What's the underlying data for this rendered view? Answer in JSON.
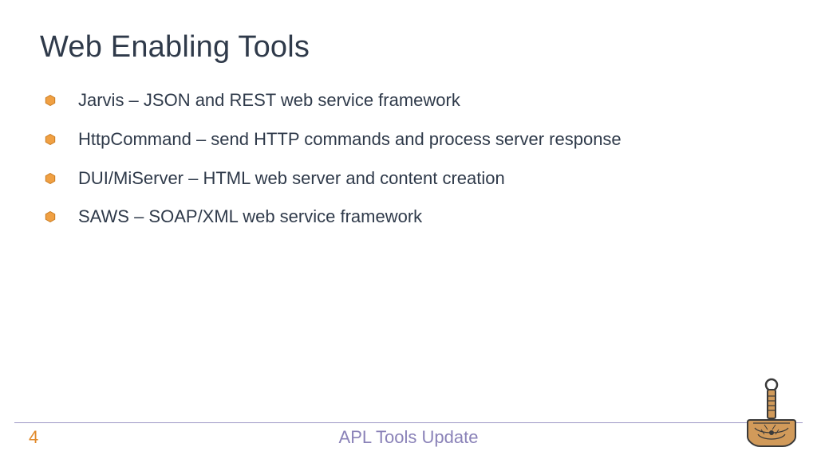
{
  "title": "Web Enabling Tools",
  "bullets": [
    "Jarvis – JSON and REST web service framework",
    "HttpCommand – send HTTP commands and process server response",
    "DUI/MiServer – HTML web server and content creation",
    "SAWS – SOAP/XML web service framework"
  ],
  "footer": {
    "page": "4",
    "title": "APL Tools Update"
  },
  "colors": {
    "accent": "#e8932f",
    "text": "#2f3a4a",
    "footer_text": "#8a82b8",
    "divider": "#9d97c6"
  }
}
